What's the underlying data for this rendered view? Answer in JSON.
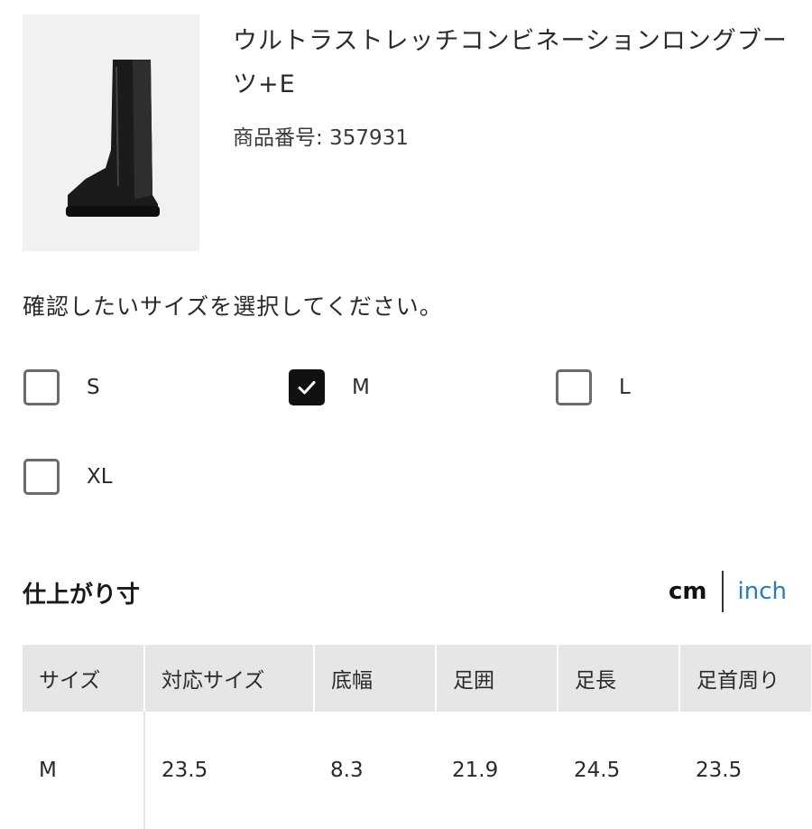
{
  "product": {
    "image_icon": "boot-image",
    "name": "ウルトラストレッチコンビネーションロングブーツ+E",
    "number_label": "商品番号: 357931"
  },
  "size_selector": {
    "prompt": "確認したいサイズを選択してください。",
    "options": [
      {
        "label": "S",
        "checked": false
      },
      {
        "label": "M",
        "checked": true
      },
      {
        "label": "L",
        "checked": false
      },
      {
        "label": "XL",
        "checked": false
      }
    ]
  },
  "measurements": {
    "title": "仕上がり寸",
    "units": {
      "cm": "cm",
      "inch": "inch",
      "active": "cm"
    },
    "headers": [
      "サイズ",
      "対応サイズ",
      "底幅",
      "足囲",
      "足長",
      "足首周り"
    ],
    "rows": [
      [
        "M",
        "23.5",
        "8.3",
        "21.9",
        "24.5",
        "23.5"
      ]
    ]
  },
  "colors": {
    "checked": "#111111",
    "link": "#2b7bb9",
    "header_bg": "#e6e6e6"
  }
}
